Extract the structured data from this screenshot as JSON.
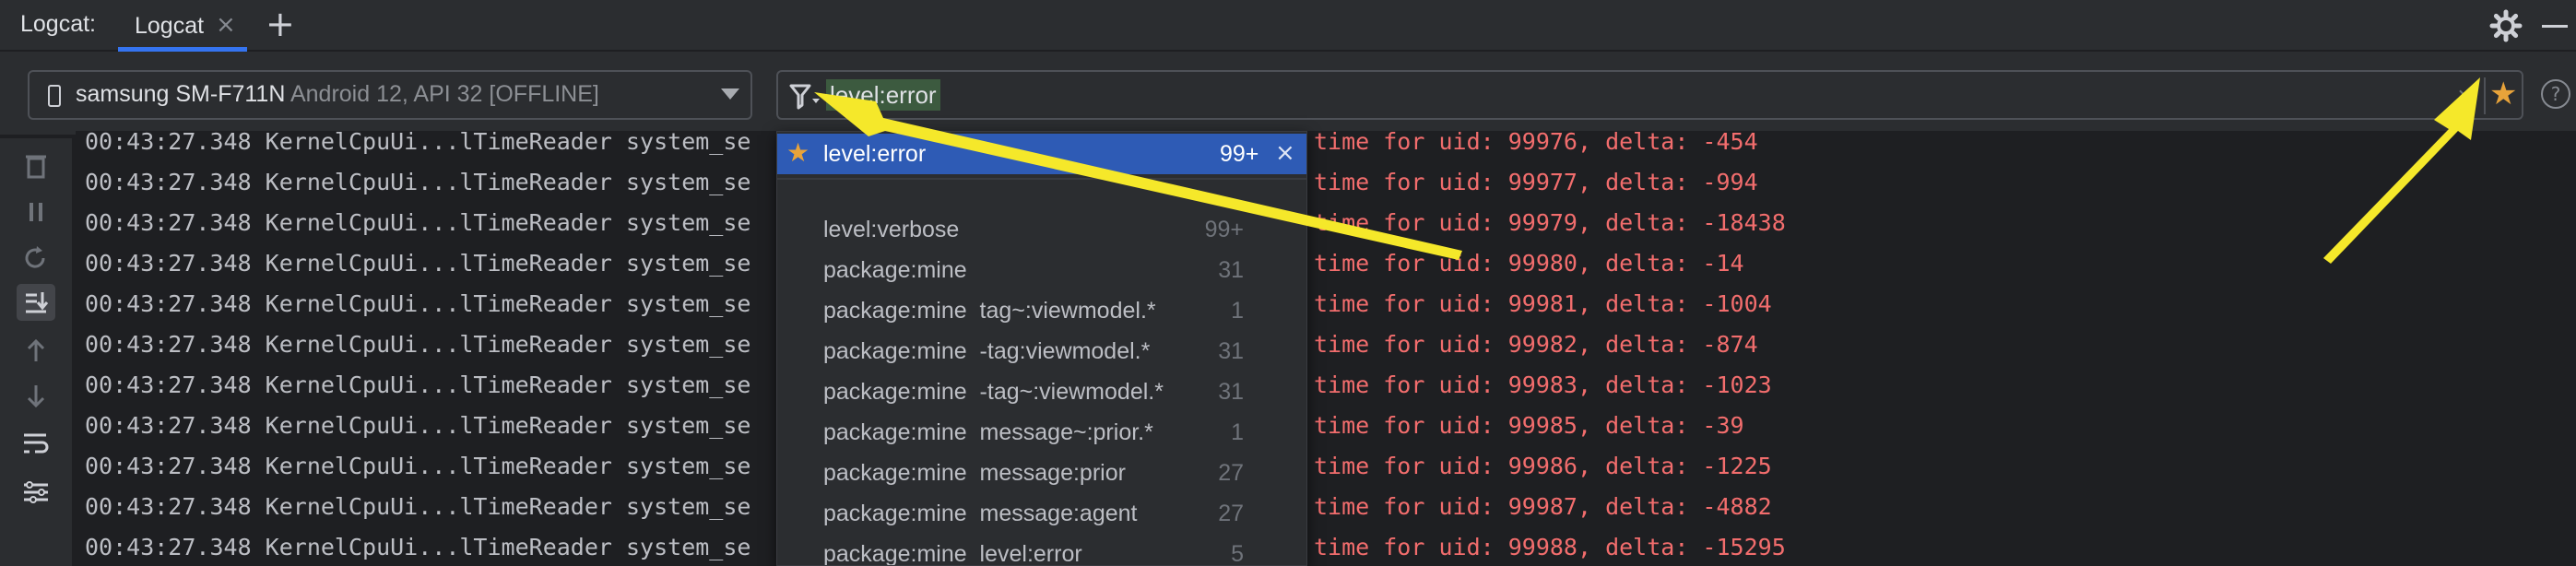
{
  "tabbar": {
    "tool_title": "Logcat:",
    "tab_label": "Logcat",
    "tab_close": "×",
    "add_tab": "+"
  },
  "device": {
    "name": "samsung SM-F711N",
    "detail": " Android 12, API 32 [OFFLINE]"
  },
  "filter": {
    "query": "level:error",
    "clear": "×",
    "favorite": "★"
  },
  "help": "?",
  "popup": {
    "selected": {
      "label": "level:error",
      "count": "99+",
      "close": "×"
    },
    "items": [
      {
        "text": "level:verbose",
        "count": "99+"
      },
      {
        "text": "package:mine",
        "count": "31"
      },
      {
        "text": "package:mine  tag~:viewmodel.*",
        "count": "1"
      },
      {
        "text": "package:mine  -tag:viewmodel.*",
        "count": "31"
      },
      {
        "text": "package:mine  -tag~:viewmodel.*",
        "count": "31"
      },
      {
        "text": "package:mine  message~:prior.*",
        "count": "1"
      },
      {
        "text": "package:mine  message:prior",
        "count": "27"
      },
      {
        "text": "package:mine  message:agent",
        "count": "27"
      },
      {
        "text": "package:mine  level:error",
        "count": "5"
      }
    ]
  },
  "log": {
    "lines": [
      {
        "left": "00:43:27.348 KernelCpuUi...lTimeReader system_se",
        "right": "time for uid: 99976, delta: -454"
      },
      {
        "left": "00:43:27.348 KernelCpuUi...lTimeReader system_se",
        "right": "time for uid: 99977, delta: -994"
      },
      {
        "left": "00:43:27.348 KernelCpuUi...lTimeReader system_se",
        "right": "time for uid: 99979, delta: -18438"
      },
      {
        "left": "00:43:27.348 KernelCpuUi...lTimeReader system_se",
        "right": "time for uid: 99980, delta: -14"
      },
      {
        "left": "00:43:27.348 KernelCpuUi...lTimeReader system_se",
        "right": "time for uid: 99981, delta: -1004"
      },
      {
        "left": "00:43:27.348 KernelCpuUi...lTimeReader system_se",
        "right": "time for uid: 99982, delta: -874"
      },
      {
        "left": "00:43:27.348 KernelCpuUi...lTimeReader system_se",
        "right": "time for uid: 99983, delta: -1023"
      },
      {
        "left": "00:43:27.348 KernelCpuUi...lTimeReader system_se",
        "right": "time for uid: 99985, delta: -39"
      },
      {
        "left": "00:43:27.348 KernelCpuUi...lTimeReader system_se",
        "right": "time for uid: 99986, delta: -1225"
      },
      {
        "left": "00:43:27.348 KernelCpuUi...lTimeReader system_se",
        "right": "time for uid: 99987, delta: -4882"
      },
      {
        "left": "00:43:27.348 KernelCpuUi...lTimeReader system_se",
        "right": "time for uid: 99988, delta: -15295"
      }
    ]
  },
  "colors": {
    "accent": "#3574f0",
    "selection": "#2e5bb5",
    "error_text": "#f26d6d",
    "star": "#e8a33a",
    "annotation_arrow": "#f5e82a"
  },
  "icons": [
    "gear-icon",
    "minimize-icon",
    "phone-icon",
    "filter-icon",
    "star-icon",
    "help-icon",
    "trash-icon",
    "pause-icon",
    "restart-icon",
    "scroll-to-end-icon",
    "up-icon",
    "down-icon",
    "soft-wrap-icon",
    "settings-icon"
  ]
}
